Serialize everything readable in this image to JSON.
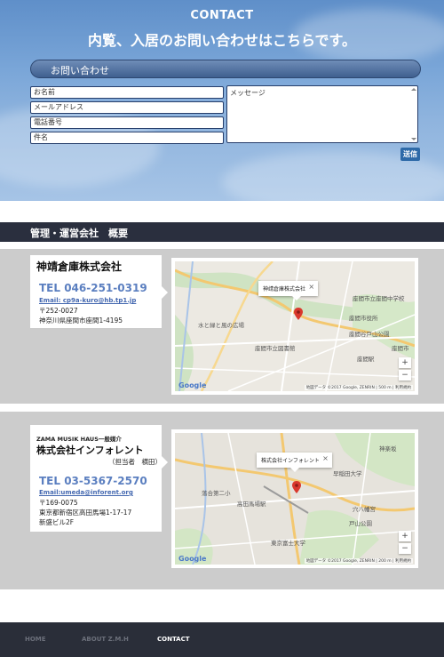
{
  "contact": {
    "title": "CONTACT",
    "subtitle": "内覧、入居のお問い合わせはこちらです。",
    "form_heading": "お問い合わせ",
    "fields": [
      "お名前",
      "メールアドレス",
      "電話番号",
      "件名"
    ],
    "message_placeholder": "メッセージ",
    "submit_label": "送信"
  },
  "company_section": {
    "heading": "管理・運営会社　概要"
  },
  "company1": {
    "name": "神靖倉庫株式会社",
    "tel": "TEL 046-251-0319",
    "email": "Email: cp9a-kuro@hb.tp1.jp",
    "postal": "〒252-0027",
    "address": "神奈川県座間市座間1-4195",
    "map": {
      "infobox": "神靖倉庫株式会社",
      "labels": [
        "座間市立座間中学校",
        "座間市役所",
        "座間谷戸山公園",
        "座間市立図書館",
        "座間市",
        "座間駅",
        "水と緑と風の広場"
      ],
      "attribution": "地図データ ©2017 Google, ZENRIN | 500 m | 利用規約",
      "google": "Google"
    }
  },
  "company2": {
    "tag": "ZAMA MUSIK HAUS一般媒介",
    "name": "株式会社インフォレント",
    "contact_person": "（担当者　横田）",
    "tel": "TEL 03-5367-2570",
    "email": "Email:umeda@inforent.org",
    "postal": "〒169-0075",
    "address1": "東京都新宿区高田馬場1-17-17",
    "address2": "新盛ビル2F",
    "map": {
      "infobox": "株式会社インフォレント",
      "labels": [
        "早稲田大学",
        "高田馬場駅",
        "戸山公園",
        "落合第二小",
        "東京富士大学",
        "神楽坂",
        "穴八幡宮"
      ],
      "attribution": "地図データ ©2017 Google, ZENRIN | 200 m | 利用規約",
      "google": "Google"
    }
  },
  "footer": {
    "nav": [
      "HOME",
      "ABOUT Z.M.H",
      "CONTACT"
    ]
  },
  "colors": {
    "accent_blue": "#5b7fc0",
    "header_dark": "#2a2f3e",
    "band_gray": "#cccccc"
  }
}
